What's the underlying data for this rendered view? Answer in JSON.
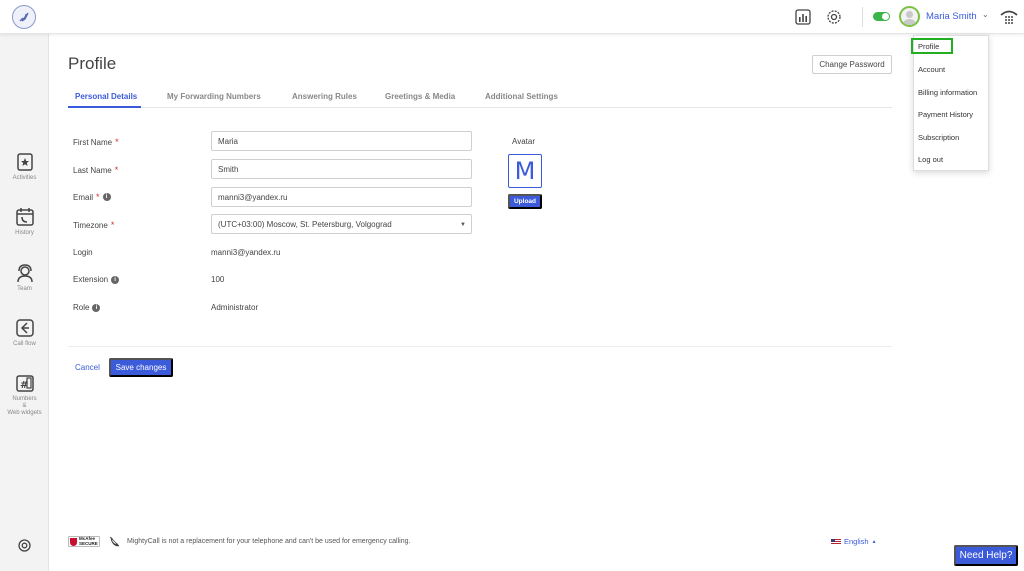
{
  "topbar": {
    "logo_icon": "rocket-logo-icon",
    "reports_icon": "bar-chart-icon",
    "settings_icon": "gear-icon",
    "status_toggle": "on",
    "status_color": "#39b54a",
    "user_name": "Maria Smith",
    "dialpad_icon": "dialpad-icon"
  },
  "sidebar": {
    "items": [
      {
        "label": "Activities",
        "icon": "star-clipboard-icon"
      },
      {
        "label": "History",
        "icon": "calendar-phone-icon"
      },
      {
        "label": "Team",
        "icon": "headset-person-icon"
      },
      {
        "label": "Call flow",
        "icon": "call-flow-icon"
      },
      {
        "label_lines": [
          "Numbers",
          "&",
          "Web widgets"
        ],
        "icon": "hash-phone-icon"
      }
    ],
    "support_icon": "lifebuoy-icon"
  },
  "main": {
    "title": "Profile",
    "change_password": "Change Password",
    "tabs": [
      {
        "label": "Personal Details",
        "active": true
      },
      {
        "label": "My Forwarding Numbers",
        "active": false
      },
      {
        "label": "Answering Rules",
        "active": false
      },
      {
        "label": "Greetings & Media",
        "active": false
      },
      {
        "label": "Additional Settings",
        "active": false
      }
    ],
    "fields": {
      "first_name": {
        "label": "First Name",
        "required": "*",
        "value": "Maria"
      },
      "last_name": {
        "label": "Last Name",
        "required": "*",
        "value": "Smith"
      },
      "email": {
        "label": "Email",
        "required": "*",
        "value": "manni3@yandex.ru"
      },
      "timezone": {
        "label": "Timezone",
        "required": "*",
        "value": "(UTC+03:00) Moscow, St. Petersburg, Volgograd"
      },
      "login": {
        "label": "Login",
        "value": "manni3@yandex.ru"
      },
      "extension": {
        "label": "Extension",
        "value": "100"
      },
      "role": {
        "label": "Role",
        "value": "Administrator"
      }
    },
    "avatar": {
      "label": "Avatar",
      "letter": "M",
      "upload": "Upload"
    },
    "cancel": "Cancel",
    "save": "Save changes",
    "accent_color": "#3b5bdb"
  },
  "footer": {
    "badge_line1": "McAfee",
    "badge_line2": "SECURE",
    "note": "MightyCall is not a replacement for your telephone and can't be used for emergency calling.",
    "language": "English",
    "need_help": "Need Help?"
  },
  "user_menu": {
    "items": [
      "Profile",
      "Account",
      "Billing information",
      "Payment History",
      "Subscription",
      "Log out"
    ],
    "highlighted": "Profile",
    "highlight_color": "#22b022"
  }
}
